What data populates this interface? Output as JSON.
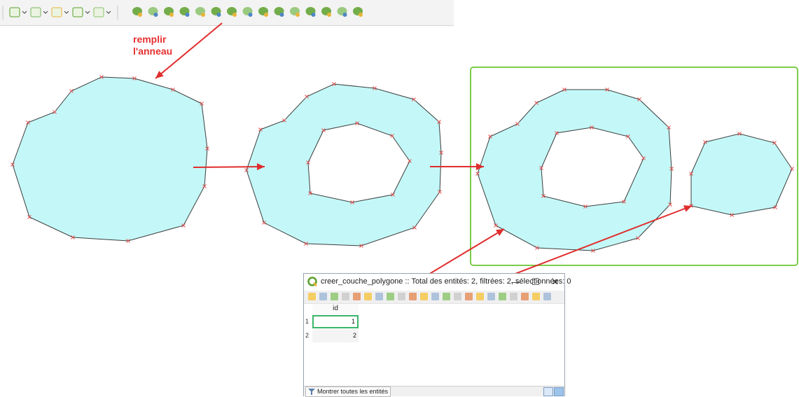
{
  "annotation": {
    "text": "remplir\nl'anneau",
    "color": "#e53030"
  },
  "colors": {
    "polygon_fill": "#c4f8f8",
    "polygon_stroke": "#3c3c3c",
    "vertex": "#e05050",
    "arrow": "#e02d2d",
    "selection_frame": "#7ccc4a"
  },
  "toolbar": {
    "icons": [
      "add-ring-tool-icon",
      "add-part-tool-icon",
      "fill-ring-tool-icon",
      "delete-ring-icon",
      "delete-part-icon",
      "reshape-icon",
      "offset-curve-icon",
      "split-features-icon",
      "split-parts-icon",
      "merge-features-icon",
      "merge-attributes-icon",
      "rotate-point-symbols-icon",
      "offset-point-symbols-icon",
      "simplify-icon",
      "trace-icon"
    ]
  },
  "attribute_table": {
    "title": "creer_couche_polygone :: Total des entités: 2, filtrées: 2, sélectionnées: 0",
    "columns": [
      "id"
    ],
    "rows": [
      {
        "row_header": "1",
        "id": "1"
      },
      {
        "row_header": "2",
        "id": "2"
      }
    ],
    "show_all_label": "Montrer toutes les entités"
  }
}
